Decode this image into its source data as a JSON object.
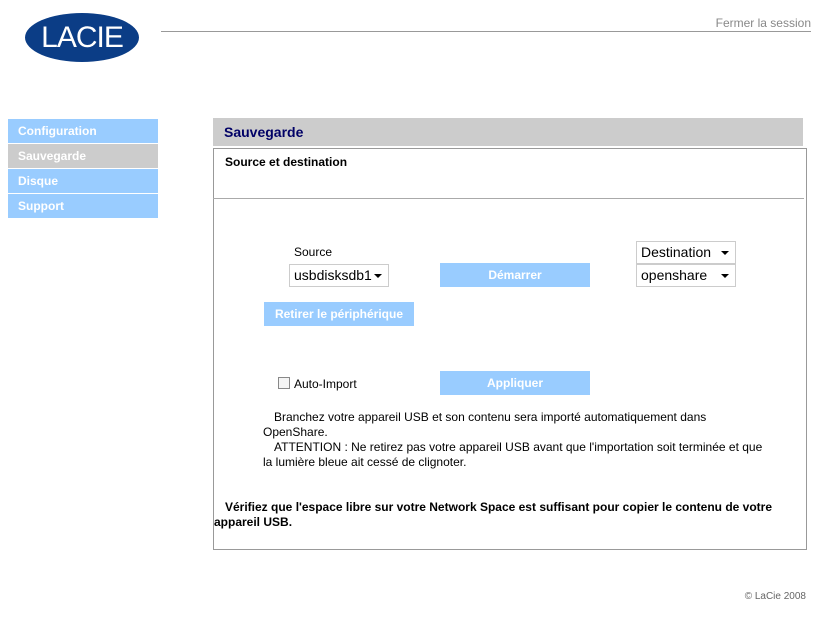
{
  "header": {
    "logo_text": "LACIE",
    "logout_label": "Fermer la session"
  },
  "sidebar": {
    "items": [
      {
        "label": "Configuration",
        "active": false
      },
      {
        "label": "Sauvegarde",
        "active": true
      },
      {
        "label": "Disque",
        "active": false
      },
      {
        "label": "Support",
        "active": false
      }
    ]
  },
  "main": {
    "title": "Sauvegarde",
    "section_title": "Source et destination",
    "source_label": "Source",
    "source_value": "usbdisksdb1",
    "destination_label": "Destination",
    "destination_value": "openshare",
    "start_button": "Démarrer",
    "remove_button": "Retirer le périphérique",
    "auto_import_label": "Auto-Import",
    "auto_import_checked": false,
    "apply_button": "Appliquer",
    "info_line1": "Branchez votre appareil USB et son contenu sera importé automatiquement dans OpenShare.",
    "info_line2": "ATTENTION : Ne retirez pas votre appareil USB avant que l'importation soit terminée et que la lumière bleue ait cessé de clignoter.",
    "warning": "Vérifiez que l'espace libre sur votre Network Space est suffisant pour copier le contenu de votre appareil USB."
  },
  "footer": {
    "copyright": "© LaCie 2008"
  }
}
